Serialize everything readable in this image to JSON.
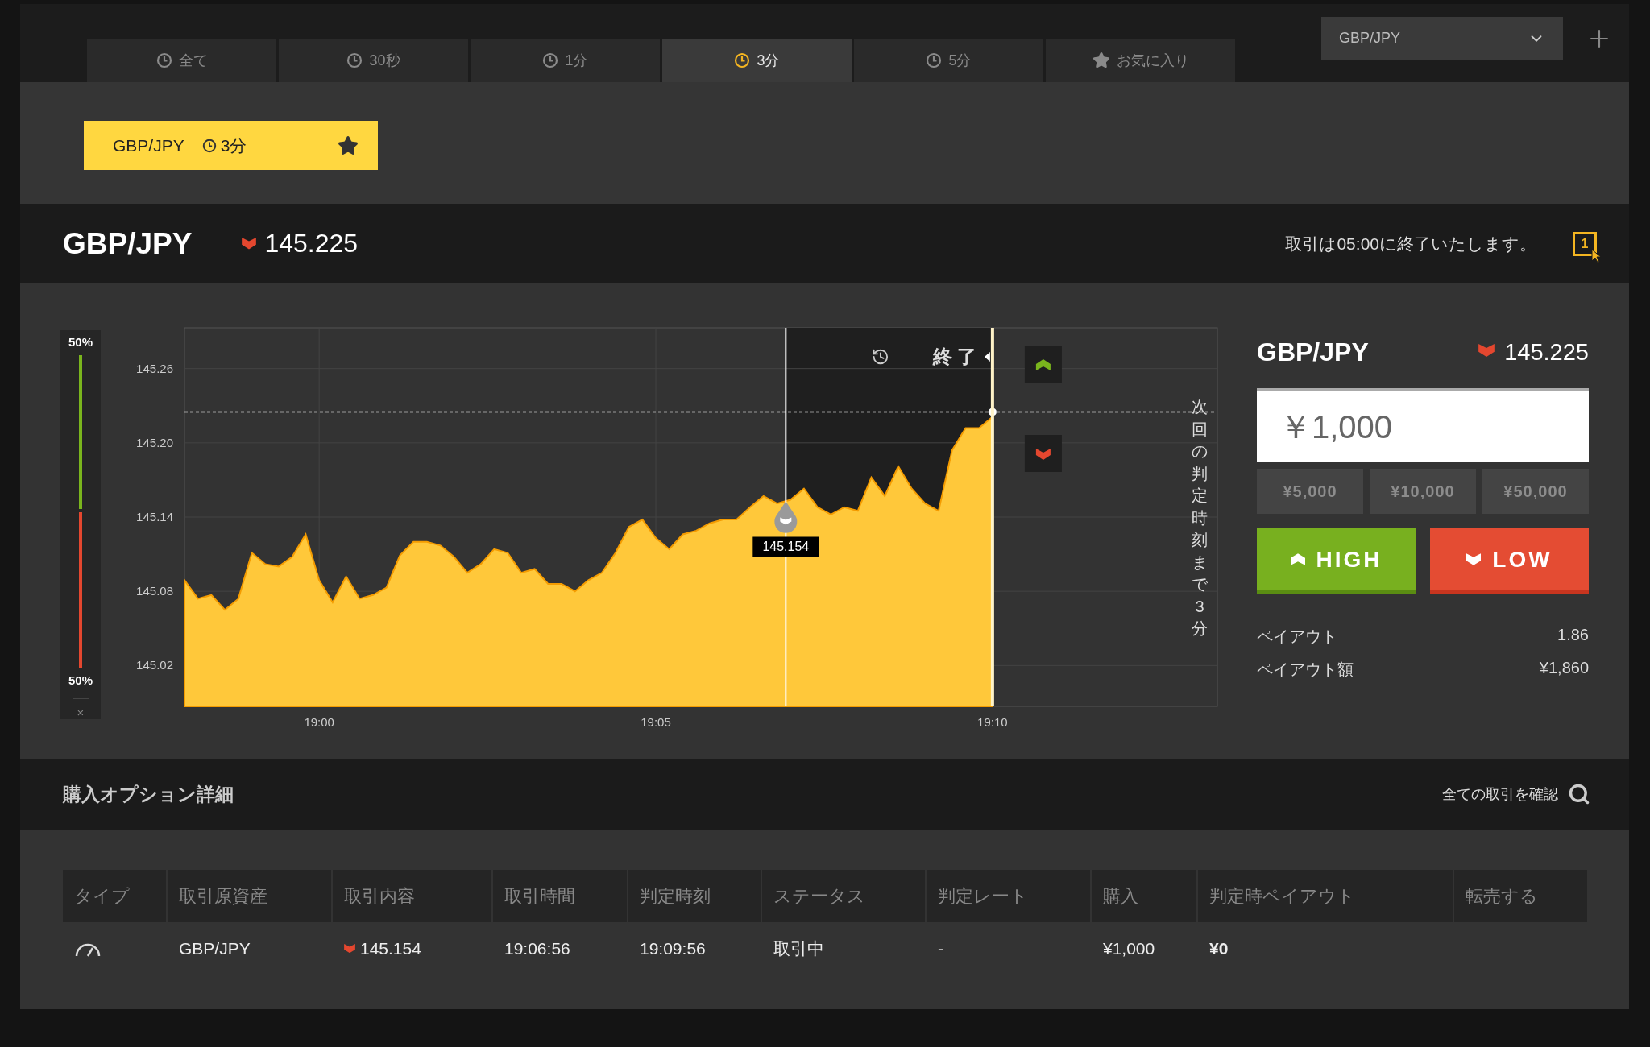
{
  "tabs": [
    {
      "label": "全て",
      "kind": "clock",
      "selected": false
    },
    {
      "label": "30秒",
      "kind": "clock",
      "selected": false
    },
    {
      "label": "1分",
      "kind": "clock",
      "selected": false
    },
    {
      "label": "3分",
      "kind": "clock",
      "selected": true
    },
    {
      "label": "5分",
      "kind": "clock",
      "selected": false
    },
    {
      "label": "お気に入り",
      "kind": "star",
      "selected": false
    }
  ],
  "pair_select": {
    "value": "GBP/JPY"
  },
  "favorite": {
    "pair": "GBP/JPY",
    "duration": "3分",
    "starred": true
  },
  "header": {
    "pair": "GBP/JPY",
    "falling": true,
    "rate": "145.225",
    "notice": "取引は05:00に終了いたします。",
    "one_click": "1"
  },
  "sentiment": {
    "high_label": "50%",
    "low_label": "50%",
    "level": 0.5,
    "close": "×"
  },
  "chart": {
    "countdown": "次回の判定時刻まで3分",
    "chart_data": {
      "type": "area",
      "categories": [
        null,
        null,
        null,
        null,
        null,
        null,
        null,
        null,
        null,
        null,
        "19:00",
        null,
        null,
        null,
        null,
        null,
        null,
        null,
        null,
        null,
        null,
        null,
        null,
        null,
        null,
        null,
        null,
        null,
        null,
        null,
        null,
        null,
        null,
        null,
        null,
        "19:05",
        null,
        null,
        null,
        null,
        null,
        null,
        null,
        null,
        null,
        null,
        null,
        null,
        null,
        null,
        null,
        null,
        null,
        null,
        null,
        null,
        null,
        null,
        null,
        null,
        "19:10"
      ],
      "grid": true,
      "series": [
        {
          "color": "#ffc83a",
          "values": [
            145.089,
            145.074,
            145.077,
            145.065,
            145.074,
            145.111,
            145.102,
            145.1,
            145.108,
            145.126,
            145.089,
            145.071,
            145.092,
            145.074,
            145.077,
            145.083,
            145.109,
            145.12,
            145.12,
            145.117,
            145.108,
            145.095,
            145.102,
            145.114,
            145.111,
            145.095,
            145.098,
            145.086,
            145.086,
            145.08,
            145.089,
            145.095,
            145.111,
            145.132,
            145.138,
            145.123,
            145.114,
            145.126,
            145.129,
            145.135,
            145.138,
            145.138,
            145.148,
            145.157,
            145.151,
            145.154,
            145.163,
            145.148,
            145.142,
            145.148,
            145.145,
            145.172,
            145.157,
            145.181,
            145.163,
            145.151,
            145.145,
            145.194,
            145.212,
            145.212,
            145.221
          ]
        }
      ],
      "ylim": [
        144.987,
        145.293
      ],
      "yticks": [
        {
          "value": 145.02,
          "label": "145.02"
        },
        {
          "value": 145.08,
          "label": "145.08"
        },
        {
          "value": 145.14,
          "label": "145.14"
        },
        {
          "value": 145.2,
          "label": "145.20"
        },
        {
          "value": 145.26,
          "label": "145.26"
        }
      ],
      "annotations": [
        "145.154",
        "終了"
      ],
      "ref_lines": [
        {
          "axis": "y",
          "value": 145.225
        }
      ]
    }
  },
  "order": {
    "pair": "GBP/JPY",
    "falling": true,
    "rate": "145.225",
    "amount": "￥1,000",
    "quick_amounts": [
      "¥5,000",
      "¥10,000",
      "¥50,000"
    ],
    "high_label": "HIGH",
    "low_label": "LOW",
    "payout_rows": [
      {
        "label": "ペイアウト",
        "value": "1.86"
      },
      {
        "label": "ペイアウト額",
        "value": "¥1,860"
      }
    ]
  },
  "positions": {
    "title": "購入オプション詳細",
    "link": "全ての取引を確認",
    "columns": [
      "タイプ",
      "取引原資産",
      "取引内容",
      "取引時間",
      "判定時刻",
      "ステータス",
      "判定レート",
      "購入",
      "判定時ペイアウト",
      "転売する"
    ],
    "rows": [
      {
        "asset": "GBP/JPY",
        "falling": true,
        "rate": "145.154",
        "trade_time": "19:06:56",
        "expiry_time": "19:09:56",
        "status": "取引中",
        "settle_rate": "-",
        "purchase": "¥1,000",
        "payout": "¥0"
      }
    ]
  }
}
